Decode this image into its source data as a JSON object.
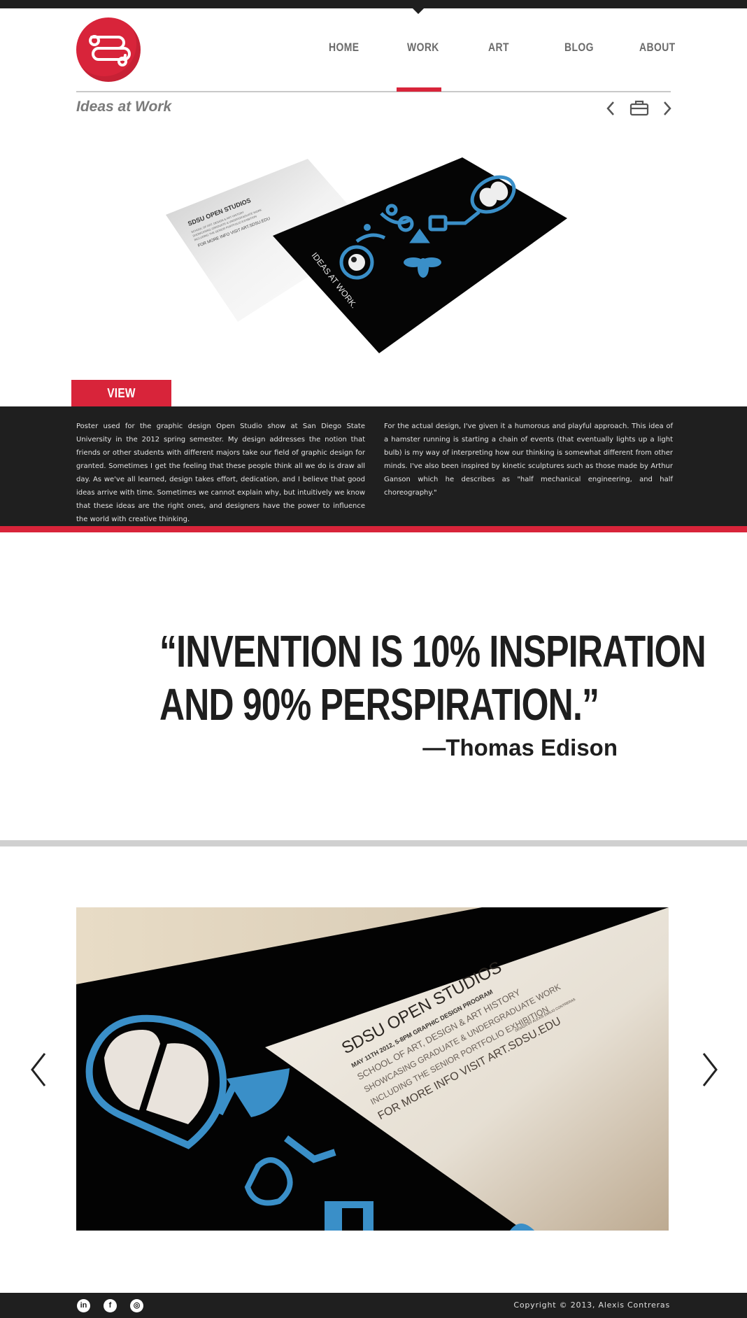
{
  "nav": {
    "items": [
      {
        "label": "HOME"
      },
      {
        "label": "WORK"
      },
      {
        "label": "ART"
      },
      {
        "label": "BLOG"
      },
      {
        "label": "ABOUT"
      }
    ],
    "active": "WORK"
  },
  "page": {
    "subtitle": "Ideas at Work"
  },
  "hero": {
    "card_back_title": "SDSU OPEN STUDIOS",
    "card_back_line": "FOR MORE INFO VISIT ART.SDSU.EDU",
    "card_front_text": "IDEAS AT WORK."
  },
  "slideshow": {
    "button_label": "VIEW SLIDESHOW >"
  },
  "description": {
    "col1": "Poster used for the graphic design Open Studio show at San Diego State University in the 2012 spring semester. My design addresses the notion that friends or other students with different majors take our field of graphic design for granted. Sometimes I get the feeling that these people think all we do is draw all day. As we've all learned, design takes effort, dedication, and I believe that good ideas arrive with time. Sometimes we cannot explain why, but intuitively we know that these ideas are the right ones, and designers have the power to influence the world with creative thinking.",
    "col2": "For the actual design, I've given it a humorous and playful approach. This idea of a hamster running is starting a chain of events (that eventually lights up a light bulb) is my way of interpreting how our thinking is somewhat different from other minds. I've also been inspired by kinetic sculptures such as those made by Arthur Ganson which he describes as \"half mechanical engineering, and half choreography.\""
  },
  "quote": {
    "line1": "“INVENTION IS 10% INSPIRATION",
    "line2": "AND 90% PERSPIRATION.”",
    "author": "—Thomas Edison"
  },
  "photo": {
    "title": "SDSU OPEN STUDIOS",
    "line1": "MAY 11TH 2012, 5-8PM  GRAPHIC DESIGN PROGRAM",
    "line2": "SCHOOL OF ART, DESIGN & ART HISTORY",
    "line3": "SHOWCASING GRADUATE & UNDERGRADUATE WORK",
    "line4": "INCLUDING THE SENIOR PORTFOLIO EXHIBITION",
    "line5": "FOR MORE INFO VISIT ART.SDSU.EDU",
    "credit": "DESIGN BY ALEXIS EMILIO CONTRERAS"
  },
  "footer": {
    "copyright": "Copyright  © 2013, Alexis Contreras",
    "social": [
      {
        "icon": "linkedin-icon",
        "glyph": "in"
      },
      {
        "icon": "facebook-icon",
        "glyph": "f"
      },
      {
        "icon": "instagram-icon",
        "glyph": "◎"
      }
    ]
  },
  "colors": {
    "accent": "#d8243a",
    "dark": "#1f1f1f",
    "blue": "#3a8fc8"
  }
}
